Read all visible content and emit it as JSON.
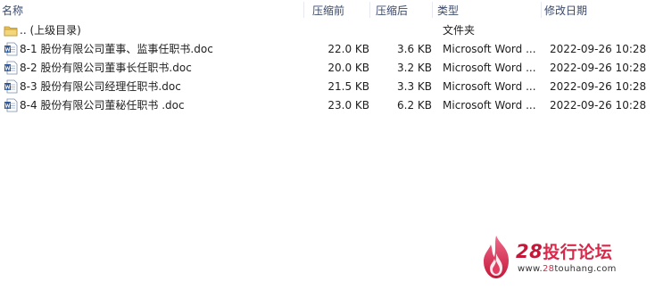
{
  "columns": {
    "name": "名称",
    "size": "压缩前",
    "compressed": "压缩后",
    "type": "类型",
    "modified": "修改日期"
  },
  "rows": [
    {
      "icon": "folder-up-icon",
      "name": ".. (上级目录)",
      "size": "",
      "compressed": "",
      "type": "文件夹",
      "modified": ""
    },
    {
      "icon": "word-doc-icon",
      "name": "8-1 股份有限公司董事、监事任职书.doc",
      "size": "22.0 KB",
      "compressed": "3.6 KB",
      "type": "Microsoft Word ...",
      "modified": "2022-09-26 10:28"
    },
    {
      "icon": "word-doc-icon",
      "name": "8-2 股份有限公司董事长任职书.doc",
      "size": "20.0 KB",
      "compressed": "3.2 KB",
      "type": "Microsoft Word ...",
      "modified": "2022-09-26 10:28"
    },
    {
      "icon": "word-doc-icon",
      "name": "8-3 股份有限公司经理任职书.doc",
      "size": "21.5 KB",
      "compressed": "3.3 KB",
      "type": "Microsoft Word ...",
      "modified": "2022-09-26 10:28"
    },
    {
      "icon": "word-doc-icon",
      "name": "8-4 股份有限公司董秘任职书 .doc",
      "size": "23.0 KB",
      "compressed": "6.2 KB",
      "type": "Microsoft Word ...",
      "modified": "2022-09-26 10:28"
    }
  ],
  "watermark": {
    "number": "28",
    "title": "投行论坛",
    "url_prefix": "www.",
    "url_accent": "28",
    "url_suffix": "touhang.com"
  },
  "colors": {
    "header_text": "#3a4a6b",
    "row_text": "#1e1e1e",
    "brand_red": "#d8294b",
    "folder_yellow": "#e8c25a",
    "word_blue": "#2b579a"
  }
}
